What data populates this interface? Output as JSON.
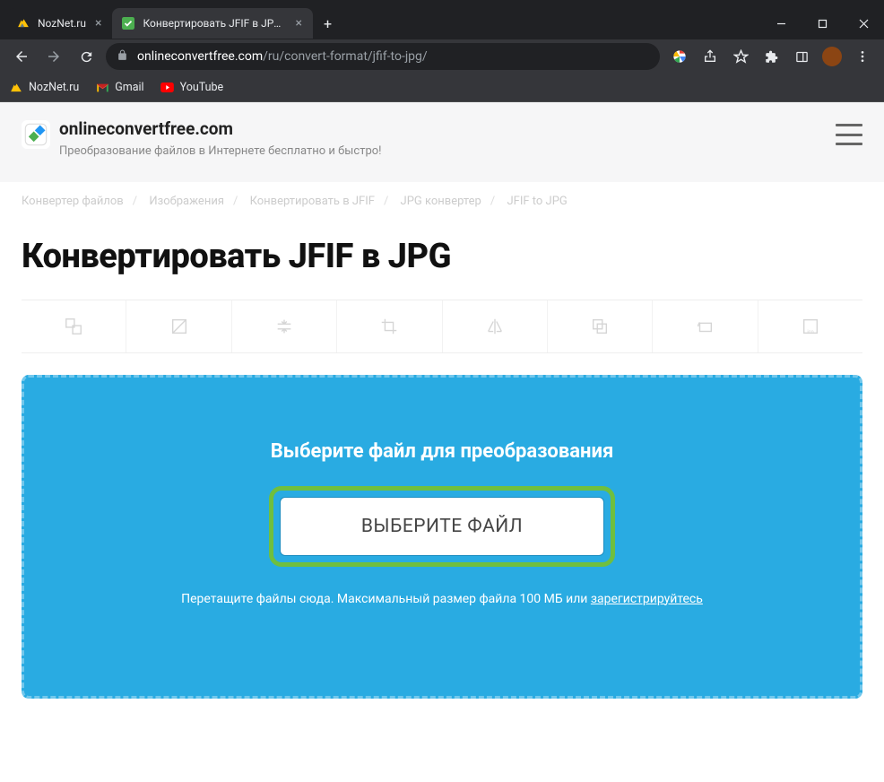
{
  "window": {
    "tabs": [
      {
        "title": "NozNet.ru",
        "active": false
      },
      {
        "title": "Конвертировать JFIF в JPG онла",
        "active": true
      }
    ],
    "url_domain": "onlineconvertfree.com",
    "url_path": "/ru/convert-format/jfif-to-jpg/"
  },
  "bookmarks": [
    {
      "label": "NozNet.ru"
    },
    {
      "label": "Gmail"
    },
    {
      "label": "YouTube"
    }
  ],
  "site": {
    "title": "onlineconvertfree.com",
    "subtitle": "Преобразование файлов в Интернете бесплатно и быстро!"
  },
  "breadcrumbs": [
    "Конвертер файлов",
    "Изображения",
    "Конвертировать в JFIF",
    "JPG конвертер",
    "JFIF to JPG"
  ],
  "page": {
    "title": "Конвертировать JFIF в JPG"
  },
  "upload": {
    "title": "Выберите файл для преобразования",
    "button": "ВЫБЕРИТЕ ФАЙЛ",
    "hint_prefix": "Перетащите файлы сюда. Максимальный размер файла 100 МБ или ",
    "hint_link": "зарегистрируйтесь"
  }
}
